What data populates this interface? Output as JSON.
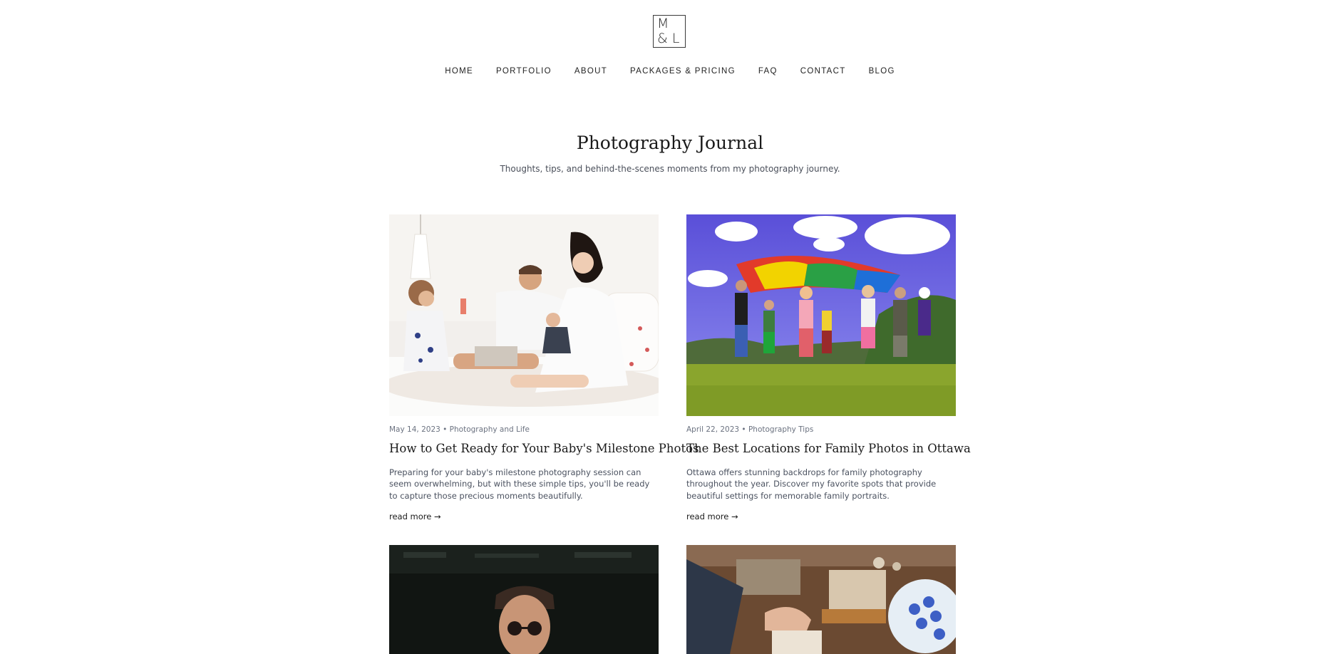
{
  "header": {
    "logo": {
      "line1": "M",
      "line2": "& L"
    },
    "nav": [
      "HOME",
      "PORTFOLIO",
      "ABOUT",
      "PACKAGES & PRICING",
      "FAQ",
      "CONTACT",
      "BLOG"
    ]
  },
  "intro": {
    "title": "Photography Journal",
    "subtitle": "Thoughts, tips, and behind-the-scenes moments from my photography journey."
  },
  "posts": [
    {
      "date": "May 14, 2023",
      "category": "Photography and Life",
      "meta": "May 14, 2023 • Photography and Life",
      "title": "How to Get Ready for Your Baby's Milestone Photos",
      "excerpt": "Preparing for your baby's milestone photography session can seem overwhelming, but with these simple tips, you'll be ready to capture those precious moments beautifully.",
      "read_more": "read more →",
      "image": "family-on-bed-photo"
    },
    {
      "date": "April 22, 2023",
      "category": "Photography Tips",
      "meta": "April 22, 2023 • Photography Tips",
      "title": "The Best Locations for Family Photos in Ottawa",
      "excerpt": "Ottawa offers stunning backdrops for family photography throughout the year. Discover my favorite spots that provide beautiful settings for memorable family portraits.",
      "read_more": "read more →",
      "image": "kids-with-parachute-photo"
    },
    {
      "image": "man-with-sunglasses-photo"
    },
    {
      "image": "crafting-table-photo"
    }
  ],
  "colors": {
    "text": "#1a1a1a",
    "muted": "#6b7280",
    "body": "#4b5260",
    "background": "#ffffff"
  }
}
